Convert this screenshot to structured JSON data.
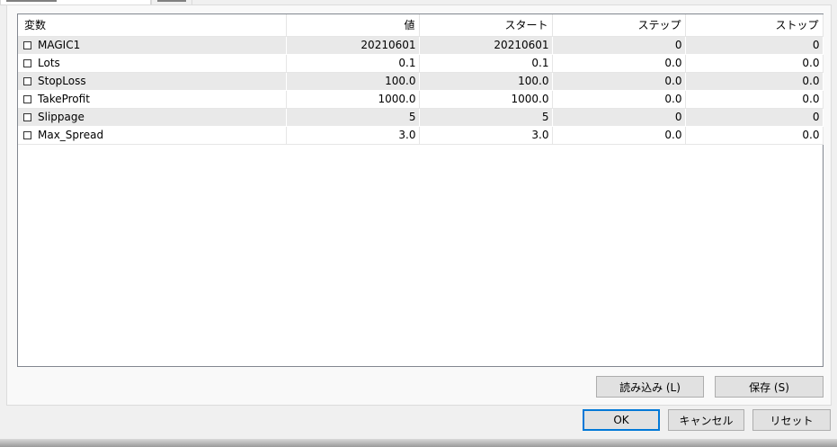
{
  "table": {
    "headers": [
      "変数",
      "値",
      "スタート",
      "ステップ",
      "ストップ"
    ],
    "rows": [
      {
        "name": "MAGIC1",
        "value": "20210601",
        "start": "20210601",
        "step": "0",
        "stop": "0"
      },
      {
        "name": "Lots",
        "value": "0.1",
        "start": "0.1",
        "step": "0.0",
        "stop": "0.0"
      },
      {
        "name": "StopLoss",
        "value": "100.0",
        "start": "100.0",
        "step": "0.0",
        "stop": "0.0"
      },
      {
        "name": "TakeProfit",
        "value": "1000.0",
        "start": "1000.0",
        "step": "0.0",
        "stop": "0.0"
      },
      {
        "name": "Slippage",
        "value": "5",
        "start": "5",
        "step": "0",
        "stop": "0"
      },
      {
        "name": "Max_Spread",
        "value": "3.0",
        "start": "3.0",
        "step": "0.0",
        "stop": "0.0"
      }
    ]
  },
  "buttons": {
    "load": "読み込み (L)",
    "save": "保存 (S)",
    "ok": "OK",
    "cancel": "キャンセル",
    "reset": "リセット"
  },
  "colors": {
    "default_button_border": "#0078d7",
    "row_alt": "#e9e9e9"
  }
}
